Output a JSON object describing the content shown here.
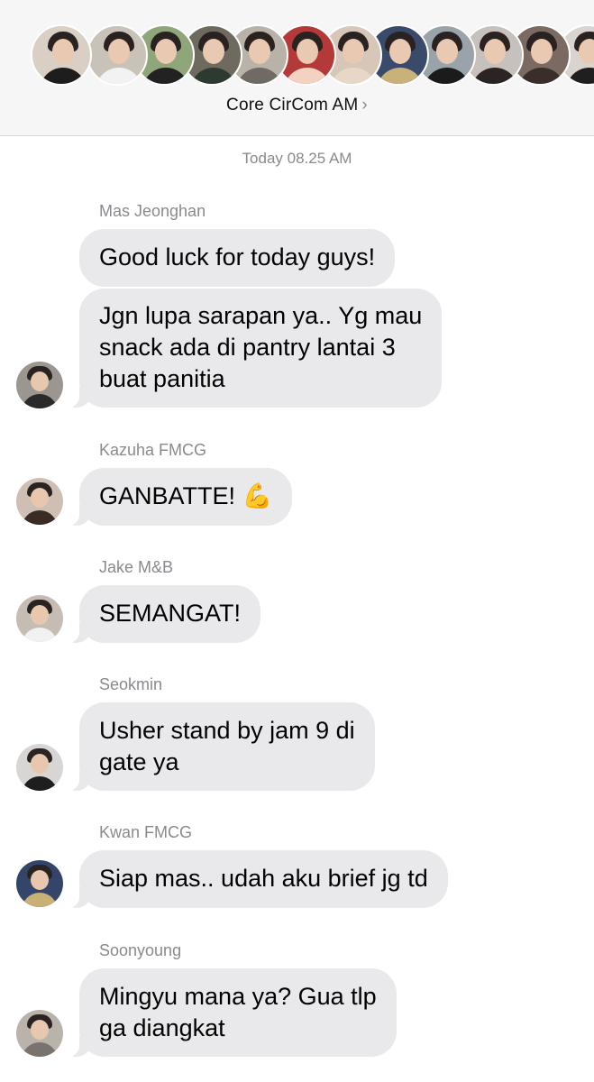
{
  "header": {
    "group_name": "Core CirCom AM",
    "chevron": "›",
    "avatars": [
      {
        "name": "member-1",
        "bg": "#d9cfc4",
        "shirt": "#1d1d1d"
      },
      {
        "name": "member-2",
        "bg": "#c9c2b8",
        "shirt": "#f2f2f2"
      },
      {
        "name": "member-3",
        "bg": "#8fa57a",
        "shirt": "#222222"
      },
      {
        "name": "member-4",
        "bg": "#6f6a60",
        "shirt": "#2d3a2f"
      },
      {
        "name": "member-5",
        "bg": "#b8b2a8",
        "shirt": "#6f6a64"
      },
      {
        "name": "member-6",
        "bg": "#b43a3a",
        "shirt": "#f3d2c2"
      },
      {
        "name": "member-7",
        "bg": "#d7c7b8",
        "shirt": "#e8d6c6"
      },
      {
        "name": "member-8",
        "bg": "#3a4a6a",
        "shirt": "#c8b27a"
      },
      {
        "name": "member-9",
        "bg": "#9aa3aa",
        "shirt": "#1b1b1b"
      },
      {
        "name": "member-10",
        "bg": "#c7c1bd",
        "shirt": "#2a2522"
      },
      {
        "name": "member-11",
        "bg": "#7a6a62",
        "shirt": "#3a2e2a"
      },
      {
        "name": "member-12",
        "bg": "#d9d4cf",
        "shirt": "#1f1f1f"
      }
    ]
  },
  "timestamp": "Today 08.25 AM",
  "messages": [
    {
      "sender": "Mas Jeonghan",
      "texts": [
        "Good luck for today guys!",
        "Jgn lupa sarapan ya.. Yg mau\nsnack ada di pantry lantai 3\nbuat panitia"
      ],
      "avatar_bg": "#9b9690",
      "avatar_shirt": "#2a2a2a"
    },
    {
      "sender": "Kazuha FMCG",
      "texts": [
        "GANBATTE! 💪"
      ],
      "avatar_bg": "#cdbfb4",
      "avatar_shirt": "#3b2b25"
    },
    {
      "sender": "Jake M&B",
      "texts": [
        "SEMANGAT!"
      ],
      "avatar_bg": "#c5bdb4",
      "avatar_shirt": "#f1f1f1"
    },
    {
      "sender": "Seokmin",
      "texts": [
        "Usher stand by jam 9 di\ngate ya"
      ],
      "avatar_bg": "#d8d6d4",
      "avatar_shirt": "#1e1e1e"
    },
    {
      "sender": "Kwan FMCG",
      "texts": [
        "Siap mas.. udah aku brief jg td"
      ],
      "avatar_bg": "#33466a",
      "avatar_shirt": "#c9b075"
    },
    {
      "sender": "Soonyoung",
      "texts": [
        "Mingyu mana ya? Gua tlp\nga diangkat"
      ],
      "avatar_bg": "#b9b3ac",
      "avatar_shirt": "#7a726c"
    }
  ]
}
